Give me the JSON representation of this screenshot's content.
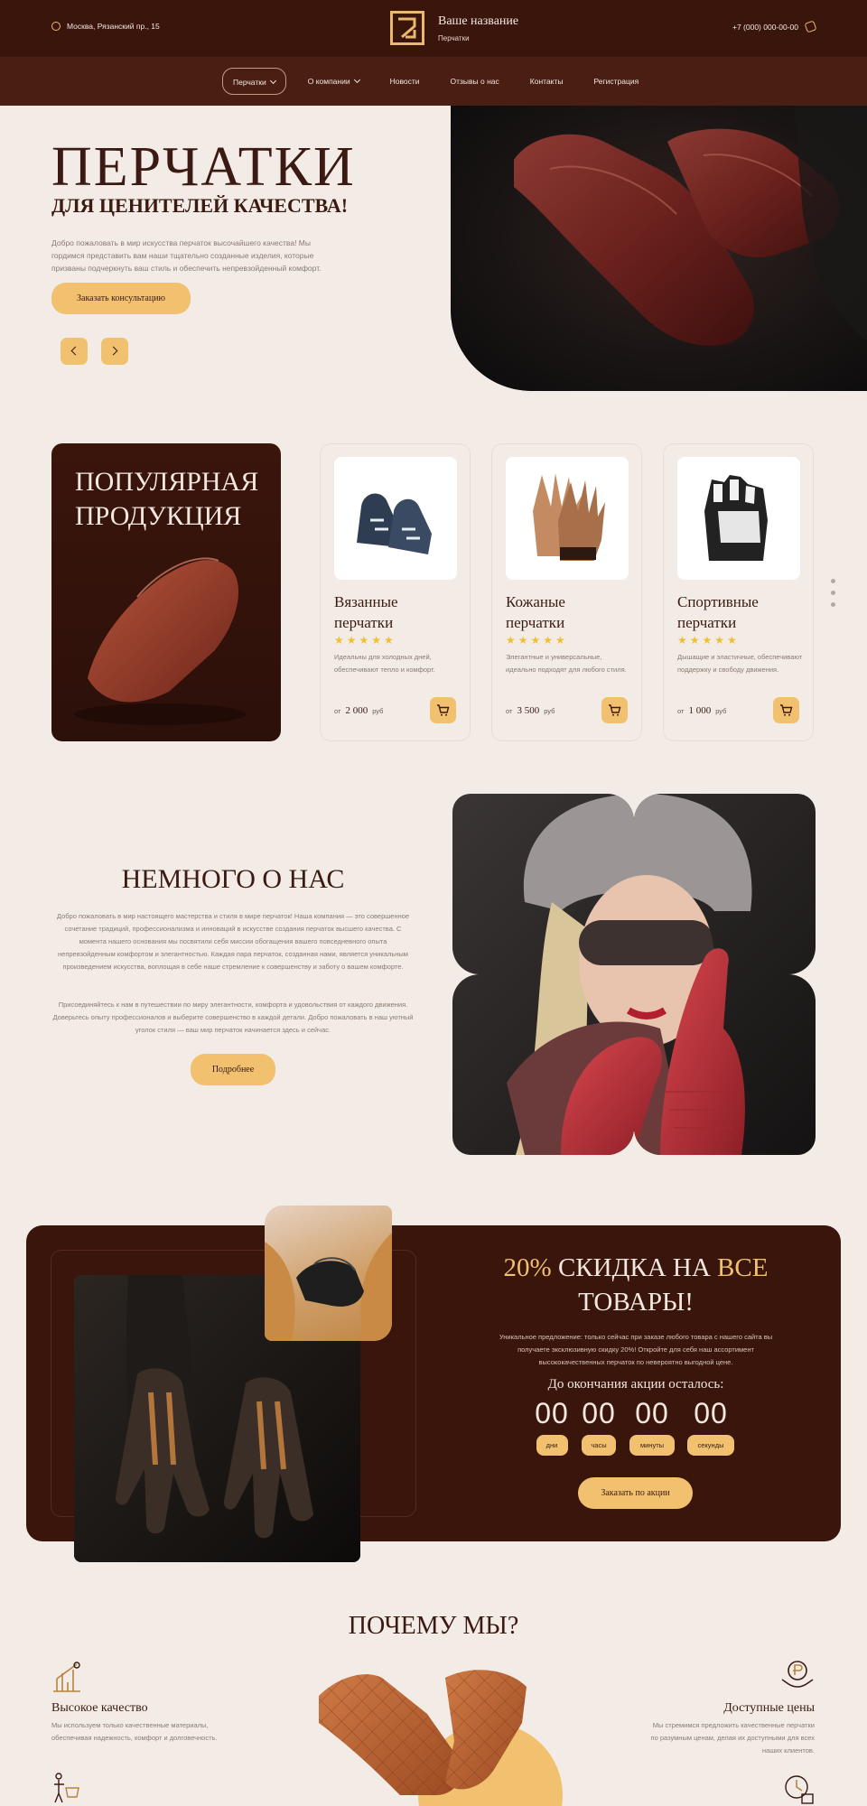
{
  "header": {
    "address": "Москва, Рязанский пр., 15",
    "brand_name": "Ваше название",
    "brand_sub": "Перчатки",
    "phone": "+7 (000) 000-00-00"
  },
  "nav": {
    "items": [
      {
        "label": "Перчатки"
      },
      {
        "label": "О компании"
      },
      {
        "label": "Новости"
      },
      {
        "label": "Отзывы о нас"
      },
      {
        "label": "Контакты"
      },
      {
        "label": "Регистрация"
      }
    ]
  },
  "hero": {
    "title": "ПЕРЧАТКИ",
    "subtitle": "ДЛЯ ЦЕНИТЕЛЕЙ КАЧЕСТВА!",
    "text": "Добро пожаловать в мир искусства перчаток высочайшего качества! Мы гордимся представить вам наши тщательно созданные изделия, которые призваны подчеркнуть ваш стиль и обеспечить непревзойденный комфорт.",
    "button": "Заказать консультацию"
  },
  "popular": {
    "title_line1": "ПОПУЛЯРНАЯ",
    "title_line2": "ПРОДУКЦИЯ",
    "products": [
      {
        "name_line1": "Вязанные",
        "name_line2": "перчатки",
        "stars": "★★★★★",
        "rating": 5,
        "desc": "Идеальны для холодных дней, обеспечивают тепло и комфорт.",
        "price_prefix": "от",
        "price": "2 000",
        "currency": "руб"
      },
      {
        "name_line1": "Кожаные",
        "name_line2": "перчатки",
        "stars": "★★★★★",
        "rating": 5,
        "desc": "Элегантные и универсальные, идеально подходят для любого стиля.",
        "price_prefix": "от",
        "price": "3 500",
        "currency": "руб"
      },
      {
        "name_line1": "Спортивные",
        "name_line2": "перчатки",
        "stars": "★★★★★",
        "rating": 5,
        "desc": "Дышащие и эластичные, обеспечивают поддержку и свободу движения.",
        "price_prefix": "от",
        "price": "1 000",
        "currency": "руб"
      }
    ]
  },
  "about": {
    "title": "НЕМНОГО О НАС",
    "p1": "Добро пожаловать в мир настоящего мастерства и стиля в мире перчаток! Наша компания — это совершенное сочетание традиций, профессионализма и инноваций в искусстве создания перчаток высшего качества. С момента нашего основания мы посвятили себя миссии обогащения вашего повседневного опыта непревзойденным комфортом и элегантностью. Каждая пара перчаток, созданная нами, является уникальным произведением искусства, воплощая в себе наше стремление к совершенству и заботу о вашем комфорте.",
    "p2": "Присоединяйтесь к нам в путешествии по миру элегантности, комфорта и удовольствия от каждого движения. Доверьтесь опыту профессионалов и выберите совершенство в каждой детали. Добро пожаловать в наш уютный уголок стиля — ваш мир перчаток начинается здесь и сейчас.",
    "button": "Подробнее"
  },
  "promo": {
    "t_pct": "20%",
    "t_mid": "СКИДКА НА",
    "t_all": "ВСЕ",
    "t_line2": "ТОВАРЫ!",
    "text": "Уникальное предложение: только сейчас при заказе любого товара с нашего сайта вы получаете эксклюзивную скидку 20%! Откройте для себя наш ассортимент высококачественных перчаток по невероятно выгодной цене.",
    "countdown_label": "До окончания акции осталось:",
    "countdown": [
      {
        "value": "00",
        "label": "дни"
      },
      {
        "value": "00",
        "label": "часы"
      },
      {
        "value": "00",
        "label": "минуты"
      },
      {
        "value": "00",
        "label": "секунды"
      }
    ],
    "button": "Заказать по акции"
  },
  "why": {
    "title": "ПОЧЕМУ МЫ?",
    "features": [
      {
        "name": "Высокое качество",
        "desc_line1": "Мы используем только качественные материалы,",
        "desc_line2": "обеспечивая надежность, комфорт и долговечность."
      },
      {
        "name": "Доступные цены",
        "desc_line1": "Мы стремимся предложить качественные перчатки",
        "desc_line2": "по разумным ценам, делая их доступными для всех",
        "desc_line3": "наших клиентов."
      }
    ]
  },
  "colors": {
    "header_bg": "#3a150c",
    "nav_bg": "#4a1e12",
    "page_bg": "#f3ece6",
    "accent_gold": "#f2c170",
    "text_dark": "#3a1a12",
    "star": "#f1bf2c"
  },
  "icons": [
    "location-icon",
    "phone-icon",
    "cart-icon",
    "chevron-left-icon",
    "chevron-right-icon",
    "quality-icon",
    "price-icon"
  ]
}
